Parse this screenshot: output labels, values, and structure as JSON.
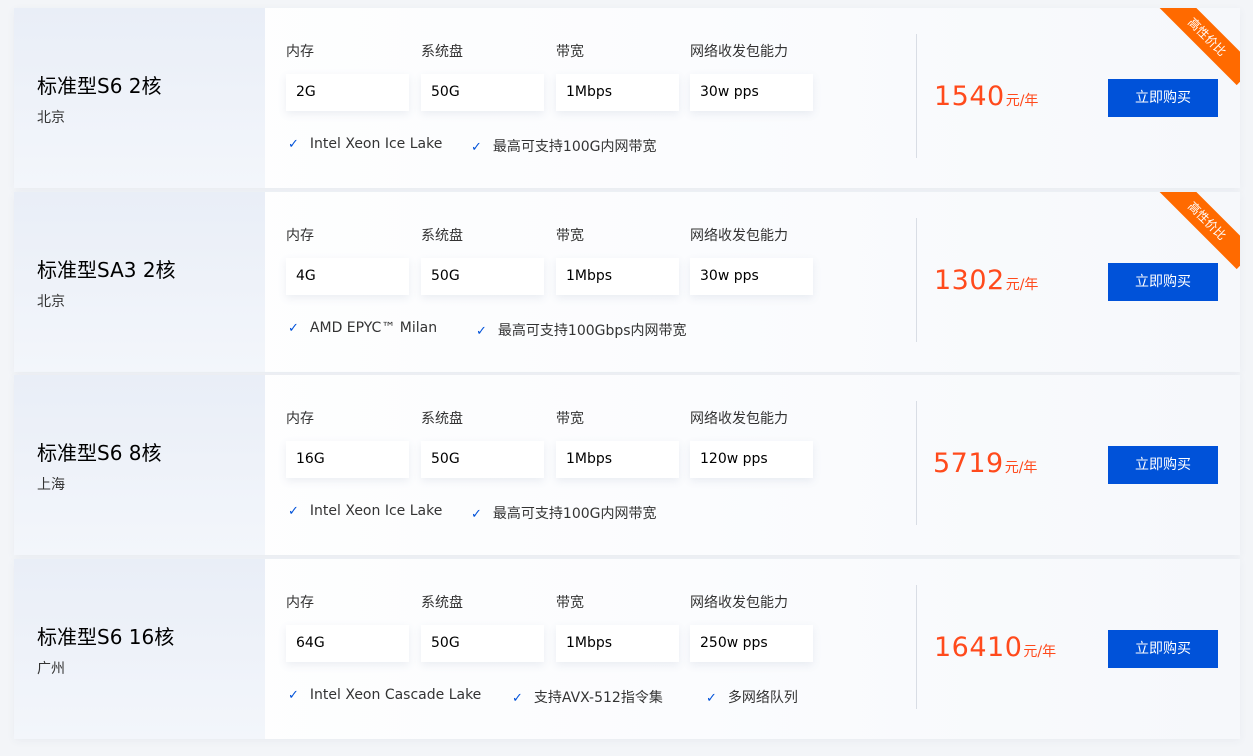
{
  "spec_labels": {
    "memory": "内存",
    "disk": "系统盘",
    "bandwidth": "带宽",
    "pps": "网络收发包能力"
  },
  "buy_label": "立即购买",
  "badge_label": "高性价比",
  "price_unit": "元/年",
  "colors": {
    "accent": "#0052d9",
    "price": "#ff4a1c",
    "badge": "#ff6a00"
  },
  "products": [
    {
      "name": "标准型S6 2核",
      "region": "北京",
      "memory": "2G",
      "disk": "50G",
      "bandwidth": "1Mbps",
      "pps": "30w pps",
      "features": [
        "Intel Xeon Ice Lake",
        "最高可支持100G内网带宽"
      ],
      "price": "1540",
      "badge": true
    },
    {
      "name": "标准型SA3 2核",
      "region": "北京",
      "memory": "4G",
      "disk": "50G",
      "bandwidth": "1Mbps",
      "pps": "30w pps",
      "features": [
        "AMD EPYC™ Milan",
        "最高可支持100Gbps内网带宽"
      ],
      "price": "1302",
      "badge": true
    },
    {
      "name": "标准型S6 8核",
      "region": "上海",
      "memory": "16G",
      "disk": "50G",
      "bandwidth": "1Mbps",
      "pps": "120w pps",
      "features": [
        "Intel Xeon Ice Lake",
        "最高可支持100G内网带宽"
      ],
      "price": "5719",
      "badge": false
    },
    {
      "name": "标准型S6 16核",
      "region": "广州",
      "memory": "64G",
      "disk": "50G",
      "bandwidth": "1Mbps",
      "pps": "250w pps",
      "features": [
        "Intel Xeon Cascade Lake",
        "支持AVX-512指令集",
        "多网络队列"
      ],
      "price": "16410",
      "badge": false
    }
  ]
}
